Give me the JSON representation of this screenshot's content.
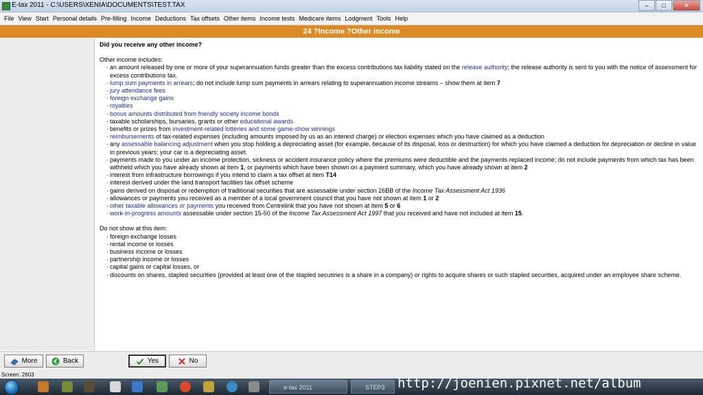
{
  "window": {
    "title": "E-tax 2011 - C:\\USERS\\XENIA\\DOCUMENTS\\TEST.TAX",
    "buttons": [
      "–",
      "□",
      "✕"
    ]
  },
  "menu": [
    "File",
    "View",
    "Start",
    "Personal details",
    "Pre-filling",
    "Income",
    "Deductions",
    "Tax offsets",
    "Other items",
    "Income tests",
    "Medicare items",
    "Lodgment",
    "Tools",
    "Help"
  ],
  "header": {
    "title": "24 ?Income ?Other income"
  },
  "content": {
    "question": "Did you receive any other income?",
    "intro": "Other income includes:",
    "items": [
      [
        {
          "t": "an amount released by one or more of your superannuation funds greater than the excess contributions tax liability stated on the "
        },
        {
          "t": "release authority",
          "link": true
        },
        {
          "t": "; the release authority is sent to you with the notice of assessment for excess contributions tax."
        }
      ],
      [
        {
          "t": "lump sum payments in arrears",
          "link": true
        },
        {
          "t": "; do not include lump sum payments in arrears relating to superannuation income streams – show them at item "
        },
        {
          "t": "7",
          "b": true
        }
      ],
      [
        {
          "t": "jury attendance fees",
          "link": true
        }
      ],
      [
        {
          "t": "foreign exchange gains",
          "link": true
        }
      ],
      [
        {
          "t": "royalties",
          "link": true
        }
      ],
      [
        {
          "t": "bonus amounts distributed from friendly society income bonds",
          "link": true
        }
      ],
      [
        {
          "t": "taxable scholarships, bursaries, grants or other "
        },
        {
          "t": "educational awards",
          "link": true
        }
      ],
      [
        {
          "t": "benefits or prizes from "
        },
        {
          "t": "investment-related lotteries and some game-show winnings",
          "link": true
        }
      ],
      [
        {
          "t": "reimbursements",
          "link": true
        },
        {
          "t": " of tax-related expenses (including amounts imposed by us as an interest charge) or election expenses which you have claimed as a deduction"
        }
      ],
      [
        {
          "t": "any "
        },
        {
          "t": "assessable balancing adjustment",
          "link": true
        },
        {
          "t": " when you stop holding a depreciating asset (for example, because of its disposal, loss or destruction) for which you have claimed a deduction for depreciation or decline in value in previous years; your car is a depreciating asset."
        }
      ],
      [
        {
          "t": "payments made to you under an income protection, sickness or accident insurance policy where the premiums were deductible and the payments replaced income; do not include payments from which tax has been withheld which you have already shown at item "
        },
        {
          "t": "1",
          "b": true
        },
        {
          "t": ", or payments which have been shown on a payment summary, which you have already shown at item "
        },
        {
          "t": "2",
          "b": true
        }
      ],
      [
        {
          "t": "interest from infrastructure borrowings if you intend to claim a tax offset at item "
        },
        {
          "t": "T14",
          "b": true
        }
      ],
      [
        {
          "t": "interest derived under the land transport facilities tax offset scheme"
        }
      ],
      [
        {
          "t": "gains derived on disposal or redemption of traditional securities that are assessable under section 26BB of the "
        },
        {
          "t": "Income Tax Assessment Act 1936",
          "i": true
        }
      ],
      [
        {
          "t": "allowances or payments you received as a member of a local government council that you have not shown at item "
        },
        {
          "t": "1",
          "b": true
        },
        {
          "t": " or "
        },
        {
          "t": "2",
          "b": true
        }
      ],
      [
        {
          "t": "other taxable allowances or payments",
          "link": true
        },
        {
          "t": " you received from Centrelink that you have not shown at item "
        },
        {
          "t": "5",
          "b": true
        },
        {
          "t": " or "
        },
        {
          "t": "6",
          "b": true
        }
      ],
      [
        {
          "t": "work-in-progress amounts",
          "link": true
        },
        {
          "t": " assessable under section 15-50 of the "
        },
        {
          "t": "Income Tax Assessment Act 1997",
          "i": true
        },
        {
          "t": " that you received and have not included at item "
        },
        {
          "t": "15",
          "b": true
        },
        {
          "t": "."
        }
      ]
    ],
    "do_not_show_heading": "Do not show at this item:",
    "do_not_show": [
      "foreign exchange losses",
      "rental income or losses",
      "business income or losses",
      "partnership income or losses",
      "capital gains or capital losses, or",
      "discounts on shares, stapled securities (provided at least one of the stapled secutiries is a share in a company) or rights to acquire shares or such stapled securities, acquired under an employee share scheme."
    ]
  },
  "buttons": {
    "more": "More",
    "back": "Back",
    "yes": "Yes",
    "no": "No"
  },
  "status": {
    "text": "Screen: 2603"
  },
  "taskbar": {
    "tasks": [
      "e-tax 2011",
      "STEP3"
    ]
  },
  "watermark": "http://joenien.pixnet.net/album",
  "colors": {
    "header": "#de8a24",
    "link": "#1f2d99"
  }
}
